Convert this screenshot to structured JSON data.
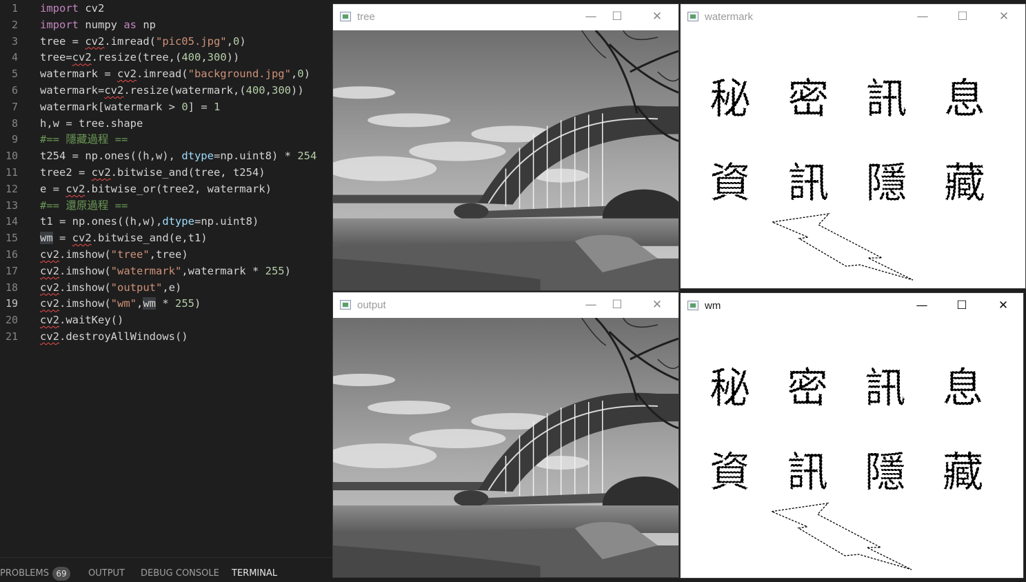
{
  "editor": {
    "lines": [
      {
        "n": "1",
        "tokens": [
          {
            "t": "import",
            "c": "kw"
          },
          {
            "t": " cv2"
          }
        ]
      },
      {
        "n": "2",
        "tokens": [
          {
            "t": "import",
            "c": "kw"
          },
          {
            "t": " numpy "
          },
          {
            "t": "as",
            "c": "kw"
          },
          {
            "t": " np"
          }
        ]
      },
      {
        "n": "3",
        "tokens": [
          {
            "t": "tree = "
          },
          {
            "t": "cv2",
            "c": "sq"
          },
          {
            "t": ".imread("
          },
          {
            "t": "\"pic05.jpg\"",
            "c": "str"
          },
          {
            "t": ","
          },
          {
            "t": "0",
            "c": "num"
          },
          {
            "t": ")"
          }
        ]
      },
      {
        "n": "4",
        "tokens": [
          {
            "t": "tree="
          },
          {
            "t": "cv2",
            "c": "sq"
          },
          {
            "t": ".resize(tree,("
          },
          {
            "t": "400",
            "c": "num"
          },
          {
            "t": ","
          },
          {
            "t": "300",
            "c": "num"
          },
          {
            "t": "))"
          }
        ]
      },
      {
        "n": "5",
        "tokens": [
          {
            "t": "watermark = "
          },
          {
            "t": "cv2",
            "c": "sq"
          },
          {
            "t": ".imread("
          },
          {
            "t": "\"background.jpg\"",
            "c": "str"
          },
          {
            "t": ","
          },
          {
            "t": "0",
            "c": "num"
          },
          {
            "t": ")"
          }
        ]
      },
      {
        "n": "6",
        "tokens": [
          {
            "t": "watermark="
          },
          {
            "t": "cv2",
            "c": "sq"
          },
          {
            "t": ".resize(watermark,("
          },
          {
            "t": "400",
            "c": "num"
          },
          {
            "t": ","
          },
          {
            "t": "300",
            "c": "num"
          },
          {
            "t": "))"
          }
        ]
      },
      {
        "n": "7",
        "tokens": [
          {
            "t": "watermark[watermark > "
          },
          {
            "t": "0",
            "c": "num"
          },
          {
            "t": "] = "
          },
          {
            "t": "1",
            "c": "num"
          }
        ]
      },
      {
        "n": "8",
        "tokens": [
          {
            "t": "h,w = tree.shape"
          }
        ]
      },
      {
        "n": "9",
        "tokens": [
          {
            "t": "#== 隱藏過程 ==",
            "c": "cmt"
          }
        ]
      },
      {
        "n": "10",
        "tokens": [
          {
            "t": "t254 = np.ones((h,w), "
          },
          {
            "t": "dtype",
            "c": "param"
          },
          {
            "t": "=np.uint8) * "
          },
          {
            "t": "254",
            "c": "num"
          }
        ]
      },
      {
        "n": "11",
        "tokens": [
          {
            "t": "tree2 = "
          },
          {
            "t": "cv2",
            "c": "sq"
          },
          {
            "t": ".bitwise_and(tree, t254)"
          }
        ]
      },
      {
        "n": "12",
        "tokens": [
          {
            "t": "e = "
          },
          {
            "t": "cv2",
            "c": "sq"
          },
          {
            "t": ".bitwise_or(tree2, watermark)"
          }
        ]
      },
      {
        "n": "13",
        "tokens": [
          {
            "t": "#== 還原過程 ==",
            "c": "cmt"
          }
        ]
      },
      {
        "n": "14",
        "tokens": [
          {
            "t": "t1 = np.ones((h,w),"
          },
          {
            "t": "dtype",
            "c": "param"
          },
          {
            "t": "=np.uint8)"
          }
        ]
      },
      {
        "n": "15",
        "tokens": [
          {
            "t": "wm",
            "c": "hl"
          },
          {
            "t": " = "
          },
          {
            "t": "cv2",
            "c": "sq"
          },
          {
            "t": ".bitwise_and(e,t1)"
          }
        ]
      },
      {
        "n": "16",
        "tokens": [
          {
            "t": "cv2",
            "c": "sq"
          },
          {
            "t": ".imshow("
          },
          {
            "t": "\"tree\"",
            "c": "str"
          },
          {
            "t": ",tree)"
          }
        ]
      },
      {
        "n": "17",
        "tokens": [
          {
            "t": "cv2",
            "c": "sq"
          },
          {
            "t": ".imshow("
          },
          {
            "t": "\"watermark\"",
            "c": "str"
          },
          {
            "t": ",watermark * "
          },
          {
            "t": "255",
            "c": "num"
          },
          {
            "t": ")"
          }
        ]
      },
      {
        "n": "18",
        "tokens": [
          {
            "t": "cv2",
            "c": "sq"
          },
          {
            "t": ".imshow("
          },
          {
            "t": "\"output\"",
            "c": "str"
          },
          {
            "t": ",e)"
          }
        ]
      },
      {
        "n": "19",
        "tokens": [
          {
            "t": "cv2",
            "c": "sq"
          },
          {
            "t": ".imshow("
          },
          {
            "t": "\"wm\"",
            "c": "str"
          },
          {
            "t": ","
          },
          {
            "t": "wm",
            "c": "hl"
          },
          {
            "t": " * "
          },
          {
            "t": "255",
            "c": "num"
          },
          {
            "t": ")"
          }
        ]
      },
      {
        "n": "20",
        "tokens": [
          {
            "t": "cv2",
            "c": "sq"
          },
          {
            "t": ".waitKey()"
          }
        ]
      },
      {
        "n": "21",
        "tokens": [
          {
            "t": "cv2",
            "c": "sq"
          },
          {
            "t": ".destroyAllWindows()"
          }
        ]
      }
    ],
    "active_line": "19"
  },
  "panel": {
    "problems_label": "PROBLEMS",
    "problems_count": "69",
    "output_label": "OUTPUT",
    "debug_label": "DEBUG CONSOLE",
    "terminal_label": "TERMINAL"
  },
  "windows": {
    "tree": {
      "title": "tree"
    },
    "watermark": {
      "title": "watermark",
      "row1": "秘密訊息",
      "row2": "資訊隱藏"
    },
    "output": {
      "title": "output"
    },
    "wm": {
      "title": "wm",
      "row1": "秘密訊息",
      "row2": "資訊隱藏"
    }
  },
  "window_buttons": {
    "minimize": "—",
    "maximize": "☐",
    "close": "✕"
  },
  "colors": {
    "editor_bg": "#1e1e1e",
    "keyword": "#c586c0",
    "string": "#ce9178",
    "number": "#b5cea8",
    "comment": "#6a9955"
  }
}
